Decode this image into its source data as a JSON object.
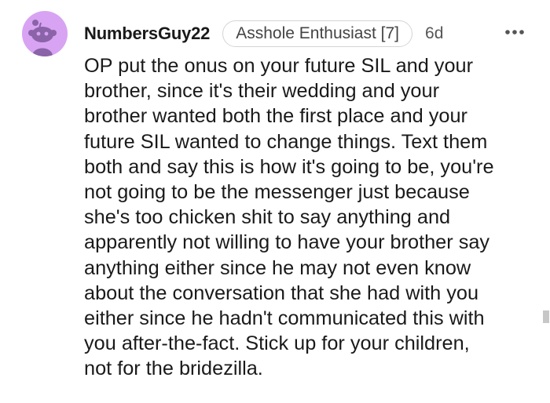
{
  "comment": {
    "author": "NumbersGuy22",
    "flair": "Asshole Enthusiast [7]",
    "age": "6d",
    "more_menu_icon": "more-horizontal-icon",
    "avatar_icon": "reddit-snoo-icon",
    "avatar_color": "#d8a3f2",
    "body_lines": [
      "OP put the onus on your future SIL and your",
      "brother, since it's their wedding and your",
      "brother wanted both the first place and your",
      "future SIL wanted to change things. Text them",
      "both and say this is how it's going to be, you're",
      "not going to be the messenger just because",
      "she's too chicken shit to say anything and",
      "apparently not willing to have your brother say",
      "anything either since he may not even know",
      "about the conversation that she had with you",
      "either since he hadn't communicated this with",
      "you after-the-fact. Stick up for your children,",
      "not for the bridezilla."
    ]
  }
}
